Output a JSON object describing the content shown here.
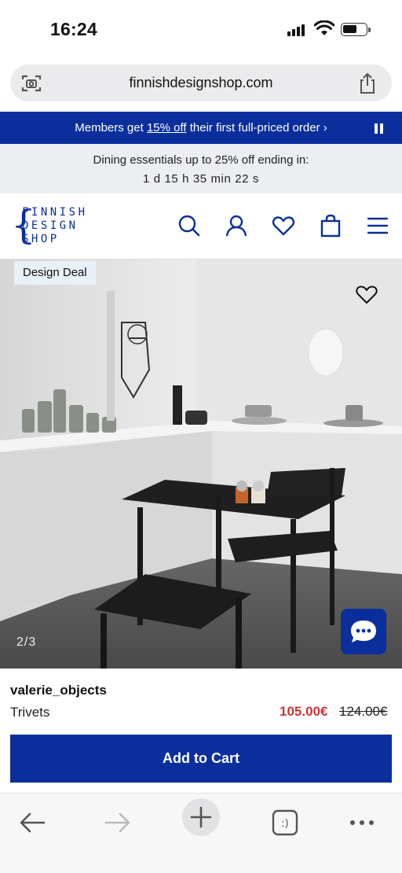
{
  "status_bar": {
    "time": "16:24"
  },
  "browser": {
    "url": "finnishdesignshop.com"
  },
  "promo": {
    "prefix": "Members get ",
    "highlight": "15% off",
    "suffix": " their first full-priced order ›"
  },
  "countdown": {
    "title": "Dining essentials up to 25% off ending in:",
    "timer": "1 d  15 h  35 min  22 s"
  },
  "header": {
    "logo_lines": [
      "FINNISH",
      "DESIGN",
      "SHOP"
    ]
  },
  "product": {
    "badge": "Design Deal",
    "image_pager": "2/3",
    "brand": "valerie_objects",
    "name": "Trivets",
    "sale_price": "105.00€",
    "original_price": "124.00€",
    "add_to_cart": "Add to Cart"
  },
  "colors": {
    "brand_blue": "#0a2f9c",
    "sale_red": "#cc3333",
    "badge_bg": "#e8f0f8"
  },
  "icons": [
    "camera-scan-icon",
    "share-icon",
    "pause-icon",
    "search-icon",
    "user-icon",
    "heart-icon",
    "bag-icon",
    "menu-icon",
    "chat-icon",
    "back-icon",
    "forward-icon",
    "plus-icon",
    "tabs-icon",
    "more-icon"
  ]
}
